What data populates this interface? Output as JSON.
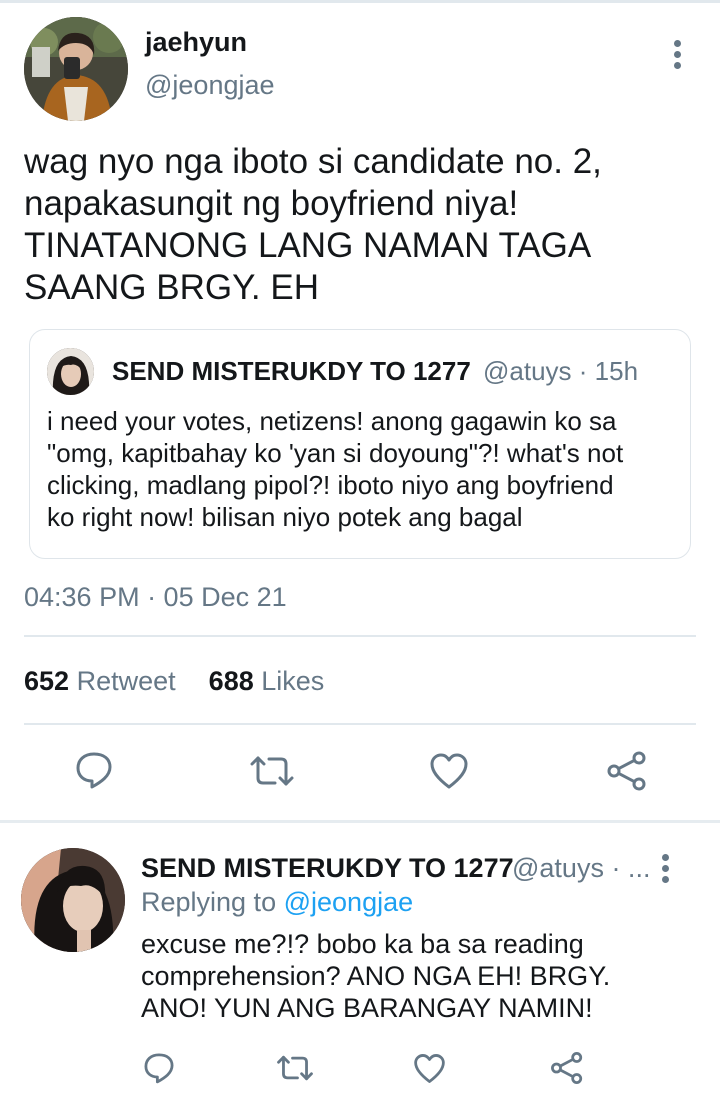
{
  "main_tweet": {
    "author": {
      "name": "jaehyun",
      "handle": "@jeongjae"
    },
    "text_lines": [
      "wag nyo nga iboto si candidate no. 2,",
      "napakasungit ng boyfriend niya!",
      "TINATANONG LANG NAMAN TAGA",
      "SAANG BRGY. EH"
    ],
    "quoted_tweet": {
      "author_name": "SEND MISTERUKDY TO 1277",
      "meta": "@atuys · 15h",
      "text_lines": [
        "i need your votes, netizens! anong gagawin ko sa",
        "\"omg, kapitbahay ko 'yan si doyoung\"?! what's not",
        "clicking, madlang pipol?! iboto niyo ang boyfriend",
        "ko right now! bilisan niyo potek ang bagal"
      ]
    },
    "timestamp": "04:36 PM · 05 Dec 21",
    "stats": {
      "retweets_count": "652",
      "retweets_label": "Retweet",
      "likes_count": "688",
      "likes_label": "Likes"
    },
    "actions": [
      "reply-icon",
      "retweet-icon",
      "like-icon",
      "share-icon"
    ]
  },
  "reply_tweet": {
    "author_name": "SEND MISTERUKDY TO 1277",
    "meta": "@atuys · ...",
    "replying_prefix": "Replying to",
    "replying_handle": "@jeongjae",
    "text_lines": [
      "excuse me?!? bobo ka ba sa reading",
      "comprehension? ANO NGA EH! BRGY.",
      "ANO! YUN ANG BARANGAY NAMIN!"
    ],
    "actions": [
      "reply-icon",
      "retweet-icon",
      "like-icon",
      "share-icon"
    ]
  },
  "colors": {
    "text_primary": "#14171a",
    "text_secondary": "#657786",
    "link": "#1da1f2",
    "divider": "#e1e8ed"
  }
}
